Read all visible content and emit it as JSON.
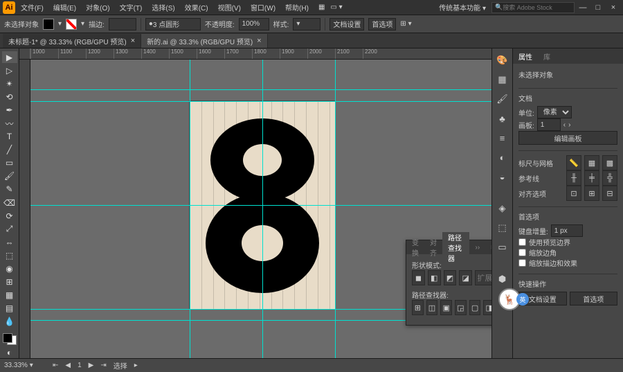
{
  "menu": {
    "logo": "Ai",
    "items": [
      "文件(F)",
      "编辑(E)",
      "对象(O)",
      "文字(T)",
      "选择(S)",
      "效果(C)",
      "视图(V)",
      "窗口(W)",
      "帮助(H)"
    ],
    "essentials": "传统基本功能",
    "search_placeholder": "搜索 Adobe Stock"
  },
  "options": {
    "noSelection": "未选择对象",
    "strokeLabel": "描边:",
    "strokeValue": "",
    "strokeStyle": "3 点圆形",
    "opacityLabel": "不透明度:",
    "opacityValue": "100%",
    "styleLabel": "样式:",
    "docSetup": "文档设置",
    "prefs": "首选项"
  },
  "tabs": [
    {
      "label": "未标题-1* @ 33.33% (RGB/GPU 预览)",
      "active": true
    },
    {
      "label": "新的.ai @ 33.3% (RGB/GPU 预览)",
      "active": false
    }
  ],
  "ruler_ticks": [
    "1000",
    "1100",
    "1200",
    "1300",
    "1400",
    "1500",
    "1600",
    "1700",
    "1800",
    "1900",
    "2000",
    "2100",
    "2200"
  ],
  "pathfinder": {
    "tabs": [
      "变换",
      "对齐",
      "路径查找器"
    ],
    "shapeModeLabel": "形状模式:",
    "expand": "扩展",
    "pathfinderLabel": "路径查找器:"
  },
  "props": {
    "tabs": [
      "属性",
      "库"
    ],
    "noSelection": "未选择对象",
    "docLabel": "文档",
    "unitLabel": "单位:",
    "unitValue": "像素",
    "artboardLabel": "画板:",
    "artboardValue": "1",
    "editArtboard": "编辑画板",
    "rulerGridLabel": "标尺与网格",
    "guidesLabel": "参考线",
    "snapLabel": "对齐选项",
    "prefsLabel": "首选项",
    "keyIncrLabel": "键盘增量:",
    "keyIncrValue": "1 px",
    "chk1": "使用预览边界",
    "chk2": "缩放边角",
    "chk3": "缩放描边和效果",
    "quickLabel": "快速操作",
    "docSetup": "文档设置",
    "prefsBtn": "首选项"
  },
  "status": {
    "zoom": "33.33%",
    "tool": "选择"
  },
  "badge": {
    "icon": "🦌",
    "ext": "英"
  }
}
